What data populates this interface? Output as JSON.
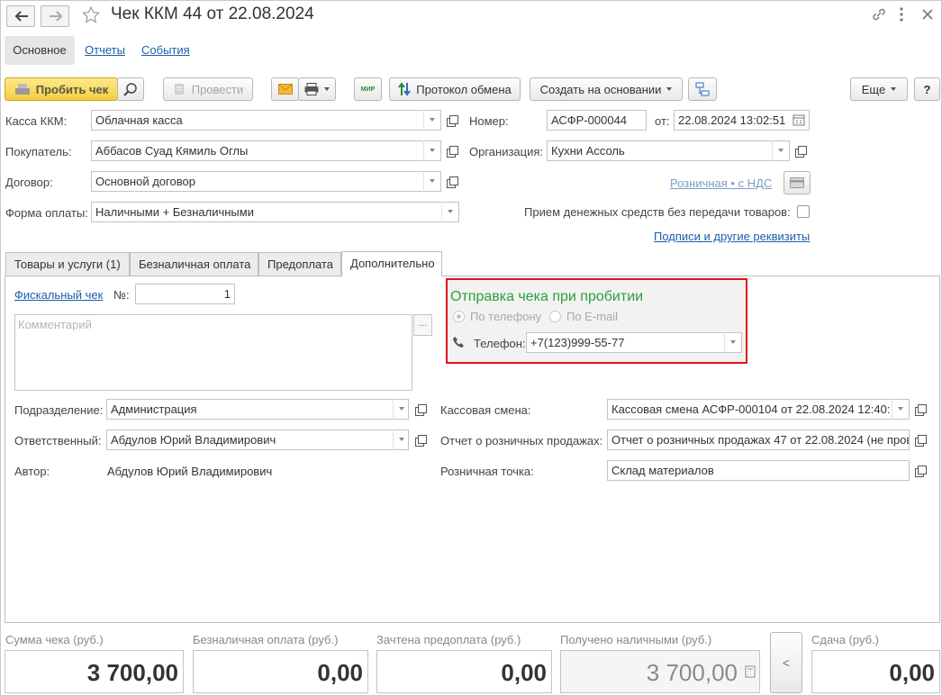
{
  "header": {
    "title": "Чек ККМ 44 от 22.08.2024"
  },
  "sections": {
    "main": "Основное",
    "reports": "Отчеты",
    "events": "События"
  },
  "toolbar": {
    "punch_label": "Пробить чек",
    "post_label": "Провести",
    "mir_label": "МИР",
    "exchange_label": "Протокол обмена",
    "create_based_label": "Создать на основании",
    "more_label": "Еще",
    "help_label": "?"
  },
  "form": {
    "kassa_label": "Касса ККМ:",
    "kassa_value": "Облачная касса",
    "buyer_label": "Покупатель:",
    "buyer_value": "Аббасов Суад Кямиль Оглы",
    "contract_label": "Договор:",
    "contract_value": "Основной договор",
    "payment_label": "Форма оплаты:",
    "payment_value": "Наличными + Безналичными",
    "number_label": "Номер:",
    "number_value": "АСФР-000044",
    "date_label": "от:",
    "date_value": "22.08.2024 13:02:51",
    "org_label": "Организация:",
    "org_value": "Кухни Ассоль",
    "price_type_link": "Розничная • с НДС",
    "no_goods_label": "Прием денежных средств без передачи товаров:",
    "signatures_link": "Подписи и другие реквизиты"
  },
  "tabs": [
    {
      "label": "Товары и услуги (1)"
    },
    {
      "label": "Безналичная оплата"
    },
    {
      "label": "Предоплата"
    },
    {
      "label": "Дополнительно"
    }
  ],
  "extra": {
    "fiscal_link": "Фискальный чек",
    "number_label": "№:",
    "number_value": "1",
    "comment_placeholder": "Комментарий",
    "ellipsis": "...",
    "send_title": "Отправка чека при пробитии",
    "by_phone": "По телефону",
    "by_email": "По E-mail",
    "phone_label": "Телефон:",
    "phone_value": "+7(123)999-55-77",
    "division_label": "Подразделение:",
    "division_value": "Администрация",
    "responsible_label": "Ответственный:",
    "responsible_value": "Абдулов Юрий Владимирович",
    "author_label": "Автор:",
    "author_value": "Абдулов Юрий Владимирович",
    "shift_label": "Кассовая смена:",
    "shift_value": "Кассовая смена АСФР-000104 от 22.08.2024 12:40:",
    "report_label": "Отчет о розничных продажах:",
    "report_value": "Отчет о розничных продажах 47 от 22.08.2024 (не пров",
    "point_label": "Розничная точка:",
    "point_value": "Склад материалов"
  },
  "footer": {
    "sum_label": "Сумма чека (руб.)",
    "sum_value": "3 700,00",
    "card_label": "Безналичная оплата (руб.)",
    "card_value": "0,00",
    "prepay_label": "Зачтена предоплата (руб.)",
    "prepay_value": "0,00",
    "cash_label": "Получено наличными (руб.)",
    "cash_value": "3 700,00",
    "back_label": "<",
    "change_label": "Сдача (руб.)",
    "change_value": "0,00"
  },
  "colors": {
    "accent_yellow": "#f5cf3c",
    "link": "#1b5fa8",
    "highlight_border": "#e3121b",
    "green_title": "#2f9e3a"
  }
}
